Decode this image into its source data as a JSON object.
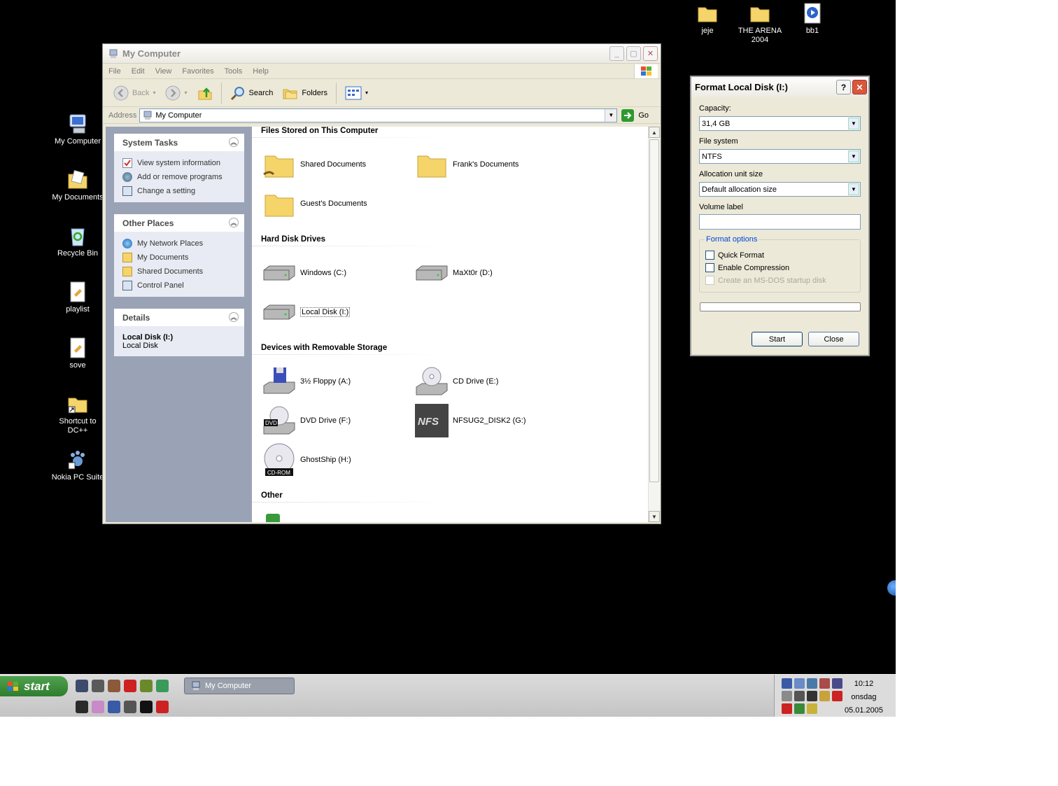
{
  "desktop": {
    "icons_left": [
      {
        "label": "My Computer",
        "icon": "my-computer-icon"
      },
      {
        "label": "My Documents",
        "icon": "my-documents-icon"
      },
      {
        "label": "Recycle Bin",
        "icon": "recycle-bin-icon"
      },
      {
        "label": "playlist",
        "icon": "playlist-file-icon"
      },
      {
        "label": "sove",
        "icon": "script-file-icon"
      },
      {
        "label": "Shortcut to DC++",
        "icon": "folder-shortcut-icon"
      },
      {
        "label": "Nokia PC Suite",
        "icon": "nokia-pc-suite-icon"
      }
    ],
    "icons_top": [
      {
        "label": "jeje",
        "icon": "folder-icon"
      },
      {
        "label": "THE ARENA 2004",
        "icon": "folder-icon"
      },
      {
        "label": "bb1",
        "icon": "media-file-icon"
      }
    ]
  },
  "explorer": {
    "title": "My Computer",
    "menu": [
      "File",
      "Edit",
      "View",
      "Favorites",
      "Tools",
      "Help"
    ],
    "toolbar": {
      "back": "Back",
      "search": "Search",
      "folders": "Folders"
    },
    "address": {
      "label": "Address",
      "value": "My Computer",
      "go": "Go"
    },
    "system_tasks": {
      "title": "System Tasks",
      "items": [
        "View system information",
        "Add or remove programs",
        "Change a setting"
      ]
    },
    "other_places": {
      "title": "Other Places",
      "items": [
        "My Network Places",
        "My Documents",
        "Shared Documents",
        "Control Panel"
      ]
    },
    "details": {
      "title": "Details",
      "name": "Local Disk (I:)",
      "type": "Local Disk"
    },
    "sections": {
      "files": {
        "title": "Files Stored on This Computer",
        "items": [
          "Shared Documents",
          "Frank's Documents",
          "Guest's Documents"
        ]
      },
      "hdd": {
        "title": "Hard Disk Drives",
        "items": [
          "Windows (C:)",
          "MaXt0r (D:)",
          "Local Disk (I:)"
        ]
      },
      "removable": {
        "title": "Devices with Removable Storage",
        "items": [
          "3½ Floppy (A:)",
          "CD Drive (E:)",
          "DVD Drive (F:)",
          "NFSUG2_DISK2 (G:)",
          "GhostShip (H:)"
        ]
      },
      "other": {
        "title": "Other"
      }
    }
  },
  "format_dialog": {
    "title": "Format Local Disk (I:)",
    "help": "?",
    "capacity_label": "Capacity:",
    "capacity_value": "31,4 GB",
    "fs_label": "File system",
    "fs_value": "NTFS",
    "alloc_label": "Allocation unit size",
    "alloc_value": "Default allocation size",
    "volume_label": "Volume label",
    "volume_value": "",
    "options_label": "Format options",
    "quick_format": "Quick Format",
    "enable_compression": "Enable Compression",
    "msdos_disk": "Create an MS-DOS startup disk",
    "start": "Start",
    "close": "Close"
  },
  "taskbar": {
    "start": "start",
    "task": "My Computer",
    "clock": {
      "time": "10:12",
      "day": "onsdag",
      "date": "05.01.2005"
    }
  }
}
